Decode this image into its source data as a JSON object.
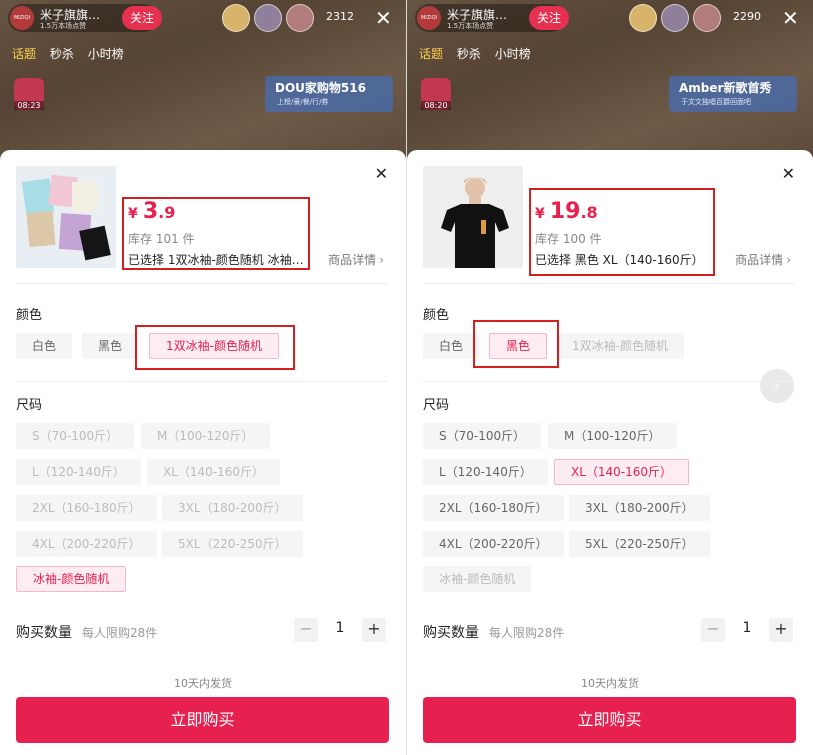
{
  "panels": [
    {
      "live": {
        "host_logo": "MIZIQI",
        "host_name": "米子旗旗…",
        "host_sub": "1.5万本场点赞",
        "follow": "关注",
        "viewer_count": "2312",
        "tags": [
          "话题",
          "秒杀",
          "小时榜"
        ],
        "gift_time": "08:23",
        "banner_title": "DOU家购物516",
        "banner_sub": "上榜/豪/餐/行/券"
      },
      "sheet": {
        "price_currency": "¥",
        "price_int": "3",
        "price_dec": ".9",
        "stock": "库存 101 件",
        "selected": "已选择  1双冰袖-颜色随机  冰袖…",
        "details": "商品详情",
        "color_label": "颜色",
        "colors": [
          {
            "label": "白色",
            "state": "normal"
          },
          {
            "label": "黑色",
            "state": "normal"
          },
          {
            "label": "1双冰袖-颜色随机",
            "state": "selected"
          }
        ],
        "size_label": "尺码",
        "sizes": [
          {
            "label": "S（70-100斤）",
            "state": "disabled"
          },
          {
            "label": "M（100-120斤）",
            "state": "disabled"
          },
          {
            "label": "L（120-140斤）",
            "state": "disabled"
          },
          {
            "label": "XL（140-160斤）",
            "state": "disabled"
          },
          {
            "label": "2XL（160-180斤）",
            "state": "disabled"
          },
          {
            "label": "3XL（180-200斤）",
            "state": "disabled"
          },
          {
            "label": "4XL（200-220斤）",
            "state": "disabled"
          },
          {
            "label": "5XL（220-250斤）",
            "state": "disabled"
          },
          {
            "label": "冰袖-颜色随机",
            "state": "selected"
          }
        ],
        "qty_label": "购买数量",
        "qty_note": "每人限购28件",
        "qty_value": "1",
        "shipping": "10天内发货",
        "buy": "立即购买"
      }
    },
    {
      "live": {
        "host_logo": "MIZIQI",
        "host_name": "米子旗旗…",
        "host_sub": "1.5万本场点赞",
        "follow": "关注",
        "viewer_count": "2290",
        "tags": [
          "话题",
          "秒杀",
          "小时榜"
        ],
        "gift_time": "08:20",
        "banner_title": "Amber新歌首秀",
        "banner_sub": "于文文独唱百爵回面吧"
      },
      "sheet": {
        "price_currency": "¥",
        "price_int": "19",
        "price_dec": ".8",
        "stock": "库存 100 件",
        "selected": "已选择  黑色 XL（140-160斤）",
        "details": "商品详情",
        "color_label": "颜色",
        "colors": [
          {
            "label": "白色",
            "state": "normal"
          },
          {
            "label": "黑色",
            "state": "selected"
          },
          {
            "label": "1双冰袖-颜色随机",
            "state": "disabled"
          }
        ],
        "size_label": "尺码",
        "sizes": [
          {
            "label": "S（70-100斤）",
            "state": "normal"
          },
          {
            "label": "M（100-120斤）",
            "state": "normal"
          },
          {
            "label": "L（120-140斤）",
            "state": "normal"
          },
          {
            "label": "XL（140-160斤）",
            "state": "selected"
          },
          {
            "label": "2XL（160-180斤）",
            "state": "normal"
          },
          {
            "label": "3XL（180-200斤）",
            "state": "normal"
          },
          {
            "label": "4XL（200-220斤）",
            "state": "normal"
          },
          {
            "label": "5XL（220-250斤）",
            "state": "normal"
          },
          {
            "label": "冰袖-颜色随机",
            "state": "disabled"
          }
        ],
        "qty_label": "购买数量",
        "qty_note": "每人限购28件",
        "qty_value": "1",
        "shipping": "10天内发货",
        "buy": "立即购买"
      }
    }
  ],
  "colors": {
    "accent": "#e6214f",
    "highlight_box": "#d31f1f"
  }
}
